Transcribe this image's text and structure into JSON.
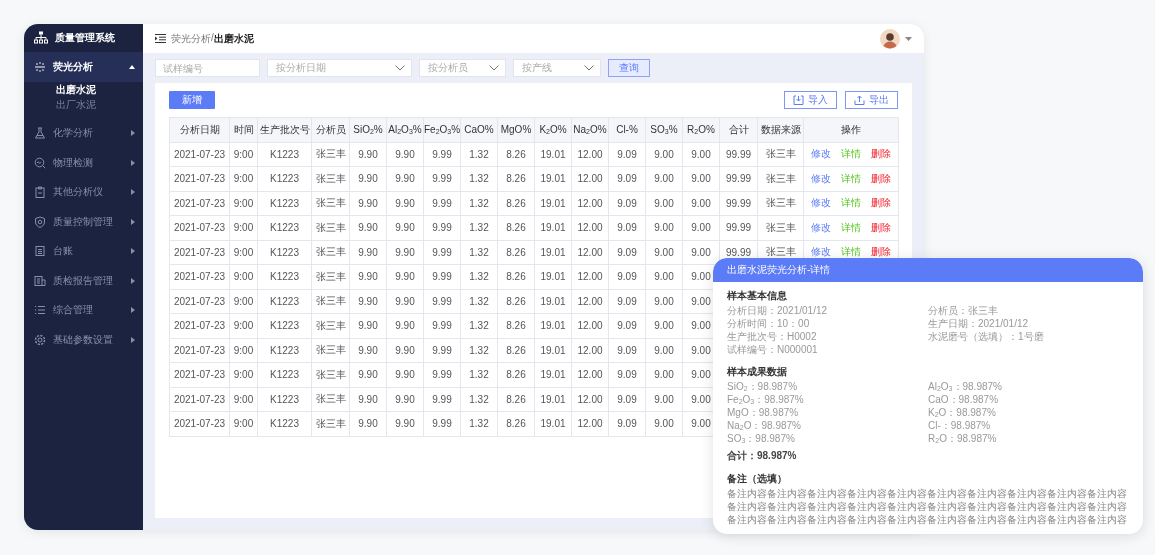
{
  "sidebar": {
    "title": "质量管理系统",
    "items": [
      {
        "label": "荧光分析",
        "expanded": true,
        "children": [
          {
            "label": "出磨水泥",
            "selected": true
          },
          {
            "label": "出厂水泥",
            "selected": false
          }
        ]
      },
      {
        "label": "化学分析",
        "expanded": false
      },
      {
        "label": "物理检测",
        "expanded": false
      },
      {
        "label": "其他分析仪",
        "expanded": false
      },
      {
        "label": "质量控制管理",
        "expanded": false
      },
      {
        "label": "台账",
        "expanded": false
      },
      {
        "label": "质检报告管理",
        "expanded": false
      },
      {
        "label": "综合管理",
        "expanded": false
      },
      {
        "label": "基础参数设置",
        "expanded": false
      }
    ]
  },
  "topbar": {
    "breadcrumb": {
      "parent": "荧光分析",
      "separator": "/",
      "current": "出磨水泥"
    }
  },
  "filters": {
    "sample_field": {
      "placeholder": "试样编号"
    },
    "selects": [
      {
        "placeholder": "按分析日期"
      },
      {
        "placeholder": "按分析员"
      },
      {
        "placeholder": "按产线"
      }
    ],
    "query_button": "查询"
  },
  "toolbar": {
    "add_button": "新增",
    "import_button": "导入",
    "export_button": "导出"
  },
  "table": {
    "columns": [
      "分析日期",
      "时间",
      "生产批次号",
      "分析员",
      "SiO$_{2}$%",
      "Al$_{2}$O$_{3}$%",
      "Fe$_{2}$O$_{3}$%",
      "CaO%",
      "MgO%",
      "K$_{2}$O%",
      "Na$_{2}$O%",
      "Cl-%",
      "SO$_{3}$%",
      "R$_{2}$O%",
      "合计",
      "数据来源",
      "操作"
    ],
    "rows": [
      {
        "cells": [
          "2021-07-23",
          "9:00",
          "K1223",
          "张三丰",
          "9.90",
          "9.90",
          "9.99",
          "1.32",
          "8.26",
          "19.01",
          "12.00",
          "9.09",
          "9.00",
          "9.00",
          "99.99",
          "张三丰"
        ],
        "actions": [
          {
            "label": "修改",
            "kind": "edit"
          },
          {
            "label": "详情",
            "kind": "detail"
          },
          {
            "label": "删除",
            "kind": "delete"
          }
        ]
      },
      {
        "cells": [
          "2021-07-23",
          "9:00",
          "K1223",
          "张三丰",
          "9.90",
          "9.90",
          "9.99",
          "1.32",
          "8.26",
          "19.01",
          "12.00",
          "9.09",
          "9.00",
          "9.00",
          "99.99",
          "张三丰"
        ],
        "actions": [
          {
            "label": "修改",
            "kind": "edit"
          },
          {
            "label": "详情",
            "kind": "detail"
          },
          {
            "label": "删除",
            "kind": "delete"
          }
        ]
      },
      {
        "cells": [
          "2021-07-23",
          "9:00",
          "K1223",
          "张三丰",
          "9.90",
          "9.90",
          "9.99",
          "1.32",
          "8.26",
          "19.01",
          "12.00",
          "9.09",
          "9.00",
          "9.00",
          "99.99",
          "张三丰"
        ],
        "actions": [
          {
            "label": "修改",
            "kind": "edit"
          },
          {
            "label": "详情",
            "kind": "detail"
          },
          {
            "label": "删除",
            "kind": "delete"
          }
        ]
      },
      {
        "cells": [
          "2021-07-23",
          "9:00",
          "K1223",
          "张三丰",
          "9.90",
          "9.90",
          "9.99",
          "1.32",
          "8.26",
          "19.01",
          "12.00",
          "9.09",
          "9.00",
          "9.00",
          "99.99",
          "张三丰"
        ],
        "actions": [
          {
            "label": "修改",
            "kind": "edit"
          },
          {
            "label": "详情",
            "kind": "detail"
          },
          {
            "label": "删除",
            "kind": "delete"
          }
        ]
      },
      {
        "cells": [
          "2021-07-23",
          "9:00",
          "K1223",
          "张三丰",
          "9.90",
          "9.90",
          "9.99",
          "1.32",
          "8.26",
          "19.01",
          "12.00",
          "9.09",
          "9.00",
          "9.00",
          "99.99",
          "张三丰"
        ],
        "actions": [
          {
            "label": "修改",
            "kind": "edit"
          },
          {
            "label": "详情",
            "kind": "detail"
          },
          {
            "label": "删除",
            "kind": "delete"
          }
        ]
      },
      {
        "cells": [
          "2021-07-23",
          "9:00",
          "K1223",
          "张三丰",
          "9.90",
          "9.90",
          "9.99",
          "1.32",
          "8.26",
          "19.01",
          "12.00",
          "9.09",
          "9.00",
          "9.00"
        ]
      },
      {
        "cells": [
          "2021-07-23",
          "9:00",
          "K1223",
          "张三丰",
          "9.90",
          "9.90",
          "9.99",
          "1.32",
          "8.26",
          "19.01",
          "12.00",
          "9.09",
          "9.00",
          "9.00"
        ]
      },
      {
        "cells": [
          "2021-07-23",
          "9:00",
          "K1223",
          "张三丰",
          "9.90",
          "9.90",
          "9.99",
          "1.32",
          "8.26",
          "19.01",
          "12.00",
          "9.09",
          "9.00",
          "9.00"
        ]
      },
      {
        "cells": [
          "2021-07-23",
          "9:00",
          "K1223",
          "张三丰",
          "9.90",
          "9.90",
          "9.99",
          "1.32",
          "8.26",
          "19.01",
          "12.00",
          "9.09",
          "9.00",
          "9.00"
        ]
      },
      {
        "cells": [
          "2021-07-23",
          "9:00",
          "K1223",
          "张三丰",
          "9.90",
          "9.90",
          "9.99",
          "1.32",
          "8.26",
          "19.01",
          "12.00",
          "9.09",
          "9.00",
          "9.00"
        ]
      },
      {
        "cells": [
          "2021-07-23",
          "9:00",
          "K1223",
          "张三丰",
          "9.90",
          "9.90",
          "9.99",
          "1.32",
          "8.26",
          "19.01",
          "12.00",
          "9.09",
          "9.00",
          "9.00"
        ]
      },
      {
        "cells": [
          "2021-07-23",
          "9:00",
          "K1223",
          "张三丰",
          "9.90",
          "9.90",
          "9.99",
          "1.32",
          "8.26",
          "19.01",
          "12.00",
          "9.09",
          "9.00",
          "9.00"
        ]
      }
    ]
  },
  "detail_card": {
    "title": "出磨水泥荧光分析-详情",
    "basic_info": {
      "title": "样本基本信息",
      "fields": [
        "分析日期：2021/01/12",
        "分析员：张三丰",
        "分析时间：10：00",
        "生产日期：2021/01/12",
        "生产批次号：H0002",
        "水泥磨号（选填）：1号磨",
        "试样编号：N000001"
      ]
    },
    "results": {
      "title": "样本成果数据",
      "fields": [
        "SiO$_{2}$：98.987%",
        "Al$_{2}$O$_{3}$：98.987%",
        "Fe$_{2}$O$_{3}$：98.987%",
        "CaO：98.987%",
        "MgO：98.987%",
        "K$_{2}$O：98.987%",
        "Na$_{2}$O：98.987%",
        "Cl-：98.987%",
        "SO$_{3}$：98.987%",
        "R$_{2}$O：98.987%"
      ],
      "total": "合计：98.987%"
    },
    "note": {
      "title": "备注（选填）",
      "text": "备注内容备注内容备注内容备注内容备注内容备注内容备注内容备注内容备注内容备注内容备注内容备注内容备注内容备注内容备注内容备注内容备注内容备注内容备注内容备注内容备注内容备注内容备注内容备注内容备注内容备注内容备注内容备注内容备注内容备注内容"
    }
  }
}
